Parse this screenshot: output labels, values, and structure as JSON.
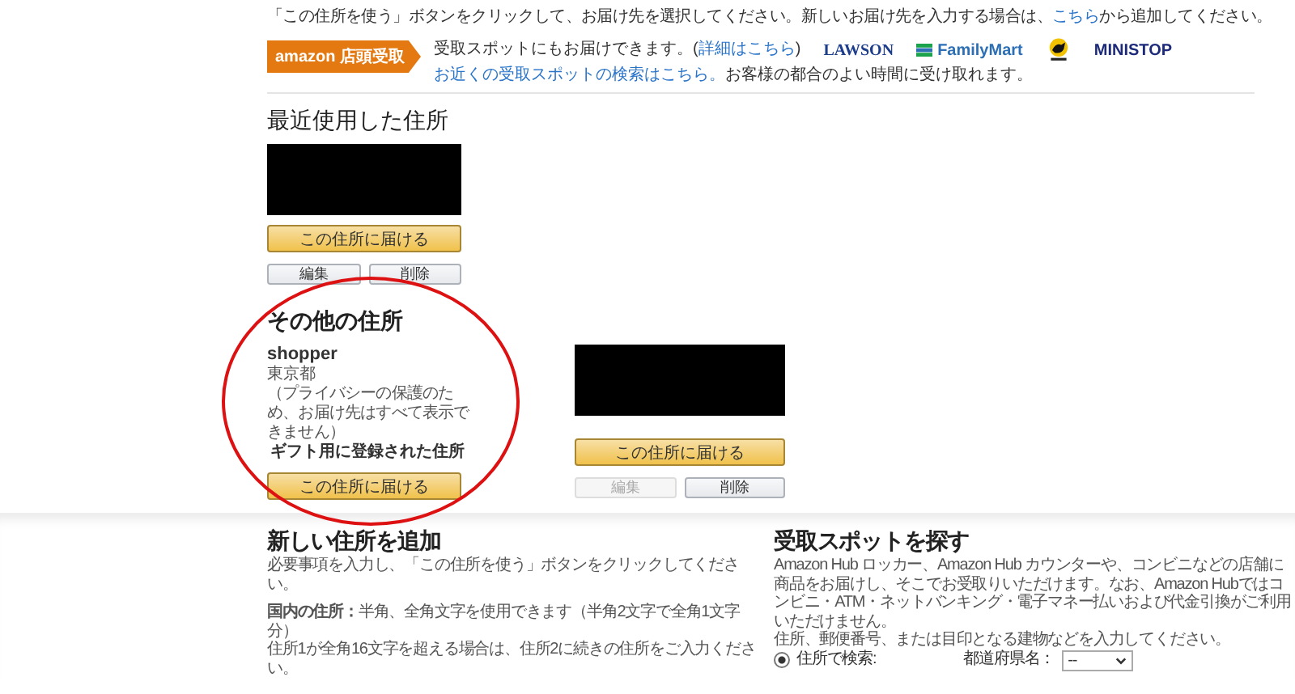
{
  "top_note": {
    "text": "「この住所を使う」ボタンをクリックして、お届け先を選択してください。新しいお届け先を入力する場合は、",
    "link": "こちら",
    "text_after": "から追加してください。"
  },
  "pickup_banner": {
    "badge": "amazon 店頭受取",
    "line1_text": "受取スポットにもお届けできます。(",
    "line1_link": "詳細はこちら",
    "line1_after": ")",
    "line2_link": "お近くの受取スポットの検索はこちら。",
    "line2_text": "お客様の都合のよい時間に受け取れます。",
    "logos": [
      {
        "kind": "serif",
        "text": "LAWSON"
      },
      {
        "kind": "stripes",
        "text": "FamilyMart"
      },
      {
        "kind": "emblem"
      },
      {
        "kind": "bold",
        "text": "MINISTOP"
      }
    ]
  },
  "recent": {
    "heading": "最近使用した住所",
    "addresses": [
      {
        "kind": "redacted",
        "deliver_button": "この住所に届ける",
        "highlighted": false,
        "edit_button": {
          "label": "編集",
          "disabled": false
        },
        "delete_button": {
          "label": "削除",
          "disabled": false
        }
      }
    ]
  },
  "others": {
    "heading": "その他の住所",
    "addresses": [
      {
        "kind": "details",
        "name": "shopper",
        "region": "東京都",
        "note": "（プライバシーの保護のため、お届け先はすべて表示できません）",
        "gift_label": "ギフト用に登録された住所",
        "deliver_button": "この住所に届ける",
        "highlighted": true
      },
      {
        "kind": "redacted",
        "deliver_button": "この住所に届ける",
        "highlighted": false,
        "edit_button": {
          "label": "編集",
          "disabled": true
        },
        "delete_button": {
          "label": "削除",
          "disabled": false
        }
      }
    ]
  },
  "add_address": {
    "heading": "新しい住所を追加",
    "instruction": "必要事項を入力し、「この住所を使う」ボタンをクリックしてください。",
    "rules": "**国内の住所：**半角、全角文字を使用できます（半角2文字で全角1文字分）",
    "rules_2": "住所1が全角16文字を超える場合は、住所2に続きの住所をご入力ください。"
  },
  "find_pickup": {
    "heading": "受取スポットを探す",
    "description": "Amazon Hub ロッカー、Amazon Hub カウンターや、コンビニなどの店舗に商品をお届けし、そこでお受取りいただけます。なお、Amazon Hubではコンビニ・ATM・ネットバンキング・電子マネー払いおよび代金引換がご利用いただけません。",
    "instruction": "住所、郵便番号、または目印となる建物などを入力してください。",
    "search_option": {
      "label": "住所で検索:",
      "selected": true
    },
    "prefecture": {
      "label": "都道府県名：",
      "value": "--"
    }
  }
}
